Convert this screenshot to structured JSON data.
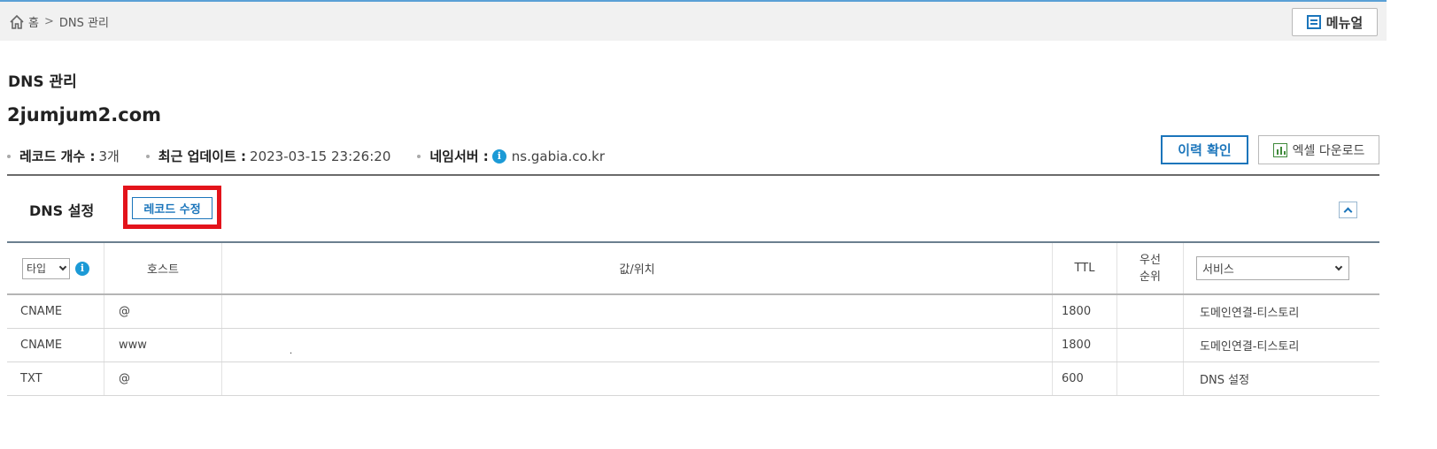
{
  "breadcrumb": {
    "home": "홈",
    "separator": ">",
    "current": "DNS 관리"
  },
  "manual_button": {
    "label": "메뉴얼",
    "icon": "document-list-icon"
  },
  "page_title": "DNS 관리",
  "domain": "2jumjum2.com",
  "info": {
    "record_count_label": "레코드 개수 :",
    "record_count_value": "3개",
    "last_update_label": "최근 업데이트 :",
    "last_update_value": "2023-03-15 23:26:20",
    "nameserver_label": "네임서버 :",
    "nameserver_value": "ns.gabia.co.kr"
  },
  "actions": {
    "history": "이력 확인",
    "excel": "엑셀 다운로드"
  },
  "section": {
    "title": "DNS 설정",
    "edit_records": "레코드 수정"
  },
  "colors": {
    "accent": "#1b75bb",
    "highlight": "#e3131b",
    "info_icon": "#1c9ad6"
  },
  "table": {
    "type_filter": "타입",
    "headers": {
      "host": "호스트",
      "value": "값/위치",
      "ttl": "TTL",
      "priority_line1": "우선",
      "priority_line2": "순위"
    },
    "service_filter": "서비스",
    "rows": [
      {
        "type": "CNAME",
        "host": "@",
        "value": "",
        "ttl": "1800",
        "priority": "",
        "service": "도메인연결-티스토리"
      },
      {
        "type": "CNAME",
        "host": "www",
        "value": ".",
        "ttl": "1800",
        "priority": "",
        "service": "도메인연결-티스토리"
      },
      {
        "type": "TXT",
        "host": "@",
        "value": "",
        "ttl": "600",
        "priority": "",
        "service": "DNS 설정"
      }
    ]
  }
}
